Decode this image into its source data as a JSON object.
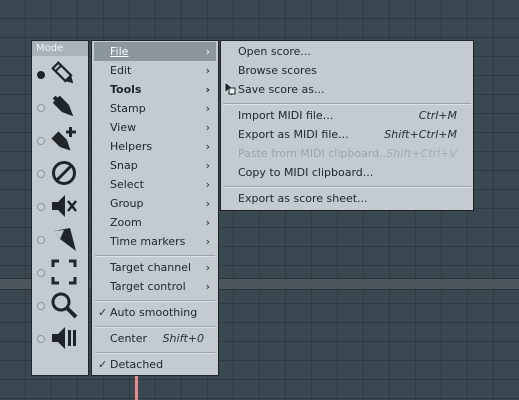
{
  "mode_panel": {
    "title": "Mode",
    "tools": [
      {
        "icon": "pencil-icon",
        "selected": true
      },
      {
        "icon": "paint-brush-icon",
        "selected": false
      },
      {
        "icon": "paint-brush-plus-icon",
        "selected": false
      },
      {
        "icon": "delete-no-icon",
        "selected": false
      },
      {
        "icon": "mute-speaker-icon",
        "selected": false
      },
      {
        "icon": "slice-knife-icon",
        "selected": false
      },
      {
        "icon": "select-marquee-icon",
        "selected": false
      },
      {
        "icon": "zoom-magnifier-icon",
        "selected": false
      },
      {
        "icon": "playback-speaker-icon",
        "selected": false
      }
    ]
  },
  "menu": {
    "file": "File",
    "edit": "Edit",
    "tools": "Tools",
    "stamp": "Stamp",
    "view": "View",
    "helpers": "Helpers",
    "snap": "Snap",
    "select": "Select",
    "group": "Group",
    "zoom": "Zoom",
    "time_markers": "Time markers",
    "target_channel": "Target channel",
    "target_control": "Target control",
    "auto_smoothing": "Auto smoothing",
    "center": "Center",
    "center_shortcut": "Shift+0",
    "detached": "Detached",
    "check_mark": "✓",
    "arrow": "›"
  },
  "file_submenu": {
    "open_score": "Open score...",
    "browse_scores": "Browse scores",
    "save_score_as": "Save score as...",
    "import_midi": "Import MIDI file...",
    "import_midi_shortcut": "Ctrl+M",
    "export_midi": "Export as MIDI file...",
    "export_midi_shortcut": "Shift+Ctrl+M",
    "paste_midi": "Paste from MIDI clipboard...",
    "paste_midi_shortcut": "Shift+Ctrl+V",
    "copy_midi": "Copy to MIDI clipboard...",
    "export_score_sheet": "Export as score sheet..."
  },
  "colors": {
    "menu_bg": "#c3cbd0",
    "highlight": "#8b969d",
    "background": "#3a4851",
    "playhead": "#e88a92"
  }
}
